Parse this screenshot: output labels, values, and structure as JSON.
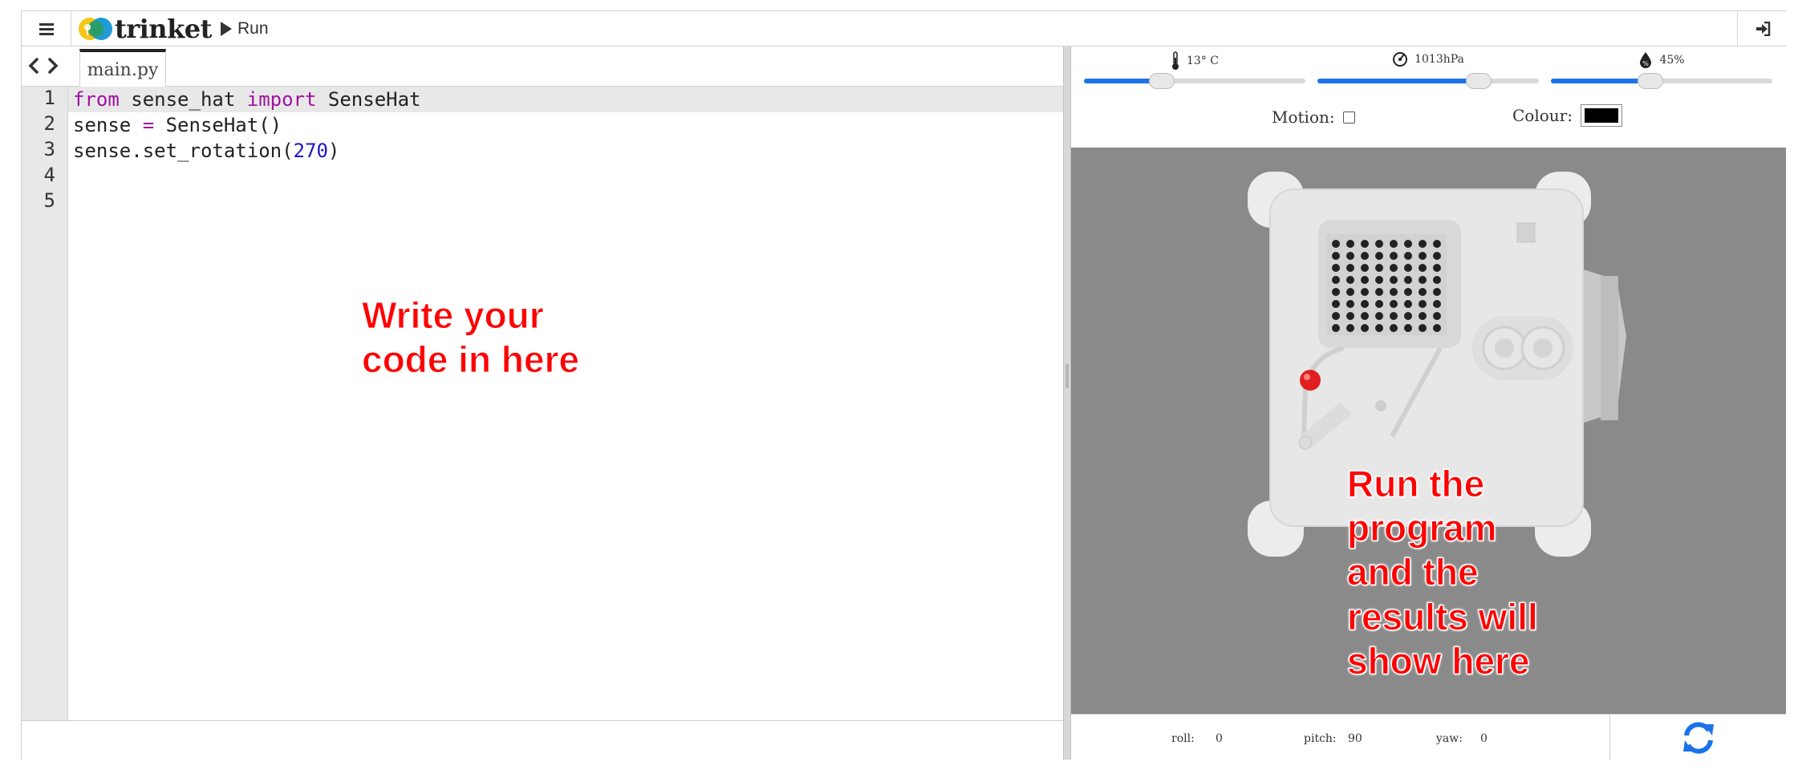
{
  "app": {
    "name": "trinket",
    "run_label": "Run"
  },
  "editor": {
    "file_tab": "main.py",
    "line_numbers": [
      "1",
      "2",
      "3",
      "4",
      "5"
    ],
    "lines": [
      {
        "t1": "from",
        "t2": " sense_hat ",
        "t3": "import",
        "t4": " SenseHat"
      },
      {
        "t1": "sense ",
        "t2": "=",
        "t3": " SenseHat()"
      },
      {
        "t1": "sense.set_rotation(",
        "t2": "270",
        "t3": ")"
      }
    ],
    "annotation": [
      "Write your",
      "code in here"
    ]
  },
  "sensors": {
    "temperature": {
      "label": "13° C",
      "level": 0.35
    },
    "pressure": {
      "label": "1013hPa",
      "level": 0.73
    },
    "humidity": {
      "label": "45%",
      "level": 0.45
    },
    "motion_label": "Motion:",
    "colour_label": "Colour:",
    "colour_value": "#000000"
  },
  "stage": {
    "annotation": [
      "Run the",
      "program",
      "and the",
      "results will",
      "show here"
    ]
  },
  "orientation": {
    "roll_label": "roll:",
    "roll": "0",
    "pitch_label": "pitch:",
    "pitch": "90",
    "yaw_label": "yaw:",
    "yaw": "0"
  },
  "colors": {
    "accent": "#1a73e8",
    "annotation": "#ff0000",
    "stage_bg": "#8a8a8a"
  },
  "icons": [
    "menu-icon",
    "login-icon",
    "code-arrows-icon",
    "thermometer-icon",
    "pressure-gauge-icon",
    "humidity-drop-icon",
    "refresh-icon"
  ]
}
